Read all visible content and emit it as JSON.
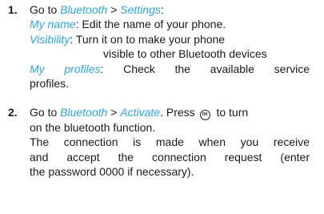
{
  "step1": {
    "number": "1.",
    "go_to": "Go to ",
    "menu_bluetooth": "Bluetooth",
    "separator": " > ",
    "menu_settings": "Settings",
    "colon": ":",
    "my_name_label": "My name",
    "my_name_text": ": Edit the name of your phone.",
    "visibility_label": "Visibility",
    "visibility_text": ": Turn it on to make your phone",
    "visibility_text_2": "visible to other Bluetooth devices",
    "my_profiles_label": "My profiles",
    "my_profiles_text": ": Check the available service",
    "my_profiles_text_2": "profiles."
  },
  "step2": {
    "number": "2.",
    "go_to": "Go to ",
    "menu_bluetooth": "Bluetooth",
    "separator": " > ",
    "menu_activate": "Activate",
    "press": ". Press",
    "ok_icon_text": "OK",
    "to_turn": "to turn",
    "line2": "on the bluetooth function.",
    "para_line1": "The connection is made when you receive",
    "para_line2": "and accept the connection request (enter",
    "para_line3": "the password 0000 if necessary)."
  }
}
